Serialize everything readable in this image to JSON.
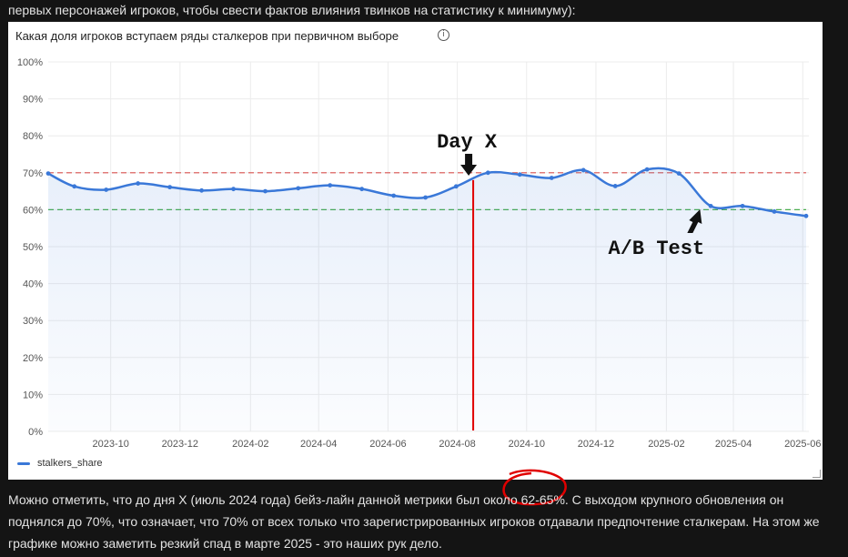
{
  "article": {
    "intro_line": "первых персонажей игроков, чтобы свести фактов влияния твинков на статистику к минимуму):",
    "conclusion_lines": [
      "Можно отметить, что до дня X (июль 2024 года) бейз-лайн данной метрики был около 62-65%. С выходом крупного обновления он",
      "поднялся до 70%, что означает, что 70% от всех только что зарегистрированных игроков отдавали предпочтение сталкерам. На этом же",
      "графике можно заметить резкий спад в марте 2025 - это наших рук дело."
    ]
  },
  "colors": {
    "line": "#3a78d8",
    "ref_70": "#d9534f",
    "ref_60": "#4caf50",
    "day_x_line": "#e00000",
    "circle": "#e00000"
  },
  "chart_data": {
    "type": "area",
    "title": "Какая доля игроков вступаем ряды сталкеров при первичном выборе",
    "xlabel": "",
    "ylabel": "",
    "ylim": [
      0,
      100
    ],
    "y_ticks": [
      "0%",
      "10%",
      "20%",
      "30%",
      "40%",
      "50%",
      "60%",
      "70%",
      "80%",
      "90%",
      "100%"
    ],
    "x_ticks": [
      "2023-10",
      "2023-12",
      "2024-02",
      "2024-04",
      "2024-06",
      "2024-08",
      "2024-10",
      "2024-12",
      "2025-02",
      "2025-04",
      "2025-06"
    ],
    "series": [
      {
        "name": "stalkers_share",
        "x": [
          "2023-08-07",
          "2023-08-30",
          "2023-09-27",
          "2023-10-25",
          "2023-11-22",
          "2023-12-20",
          "2024-01-17",
          "2024-02-14",
          "2024-03-14",
          "2024-04-11",
          "2024-05-09",
          "2024-06-06",
          "2024-07-04",
          "2024-07-31",
          "2024-08-28",
          "2024-09-25",
          "2024-10-23",
          "2024-11-20",
          "2024-12-18",
          "2025-01-15",
          "2025-02-12",
          "2025-03-12",
          "2025-04-09",
          "2025-05-07",
          "2025-06-04"
        ],
        "values": [
          69.8,
          66.3,
          65.4,
          67.1,
          66.1,
          65.2,
          65.6,
          65.0,
          65.8,
          66.6,
          65.6,
          63.8,
          63.3,
          66.3,
          70.0,
          69.5,
          68.6,
          70.7,
          66.4,
          70.9,
          69.8,
          61.0,
          61.0,
          59.5,
          58.3
        ]
      }
    ],
    "reference_lines": [
      70,
      60
    ],
    "grid": true,
    "legend": "bottom-left",
    "annotations": [
      {
        "text": "Day X",
        "x": "2024-08-15"
      },
      {
        "text": "A/B Test",
        "x": "2025-03-01"
      }
    ]
  }
}
